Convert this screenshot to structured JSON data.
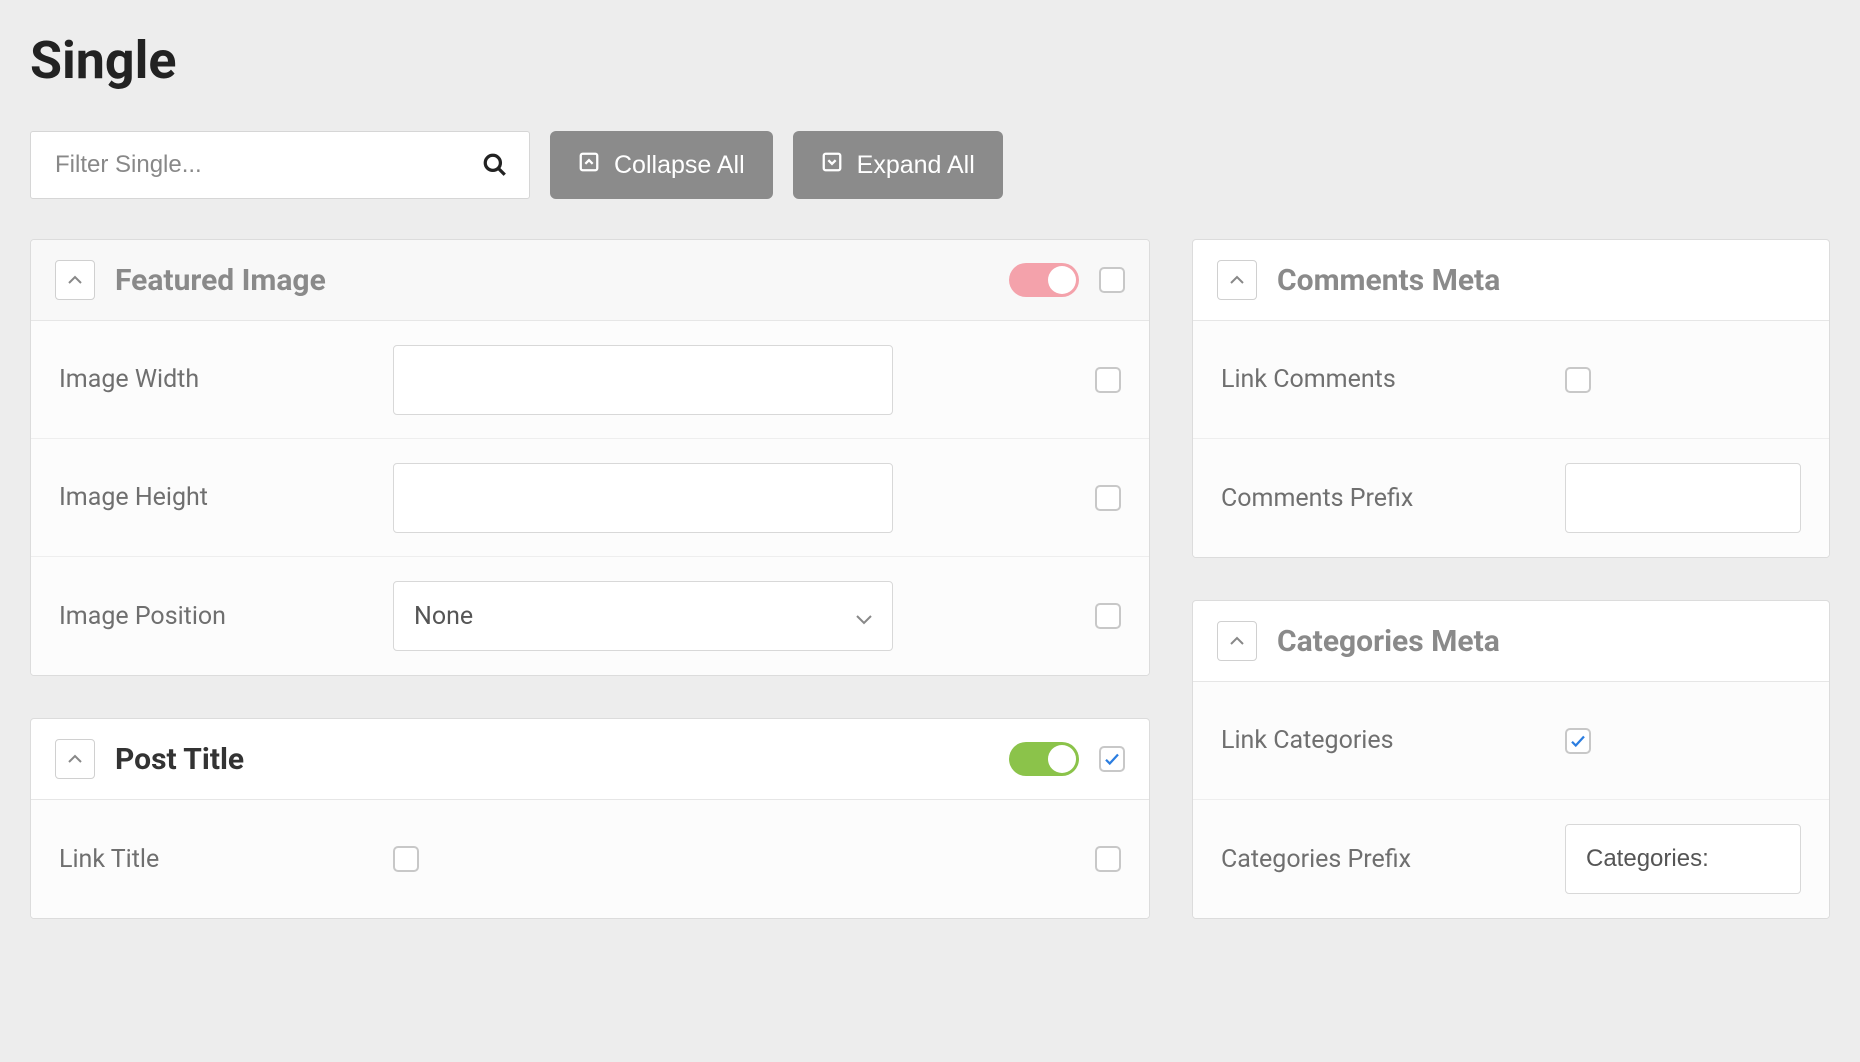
{
  "page": {
    "title": "Single"
  },
  "toolbar": {
    "filter_placeholder": "Filter Single...",
    "collapse_label": "Collapse All",
    "expand_label": "Expand All"
  },
  "panels": {
    "featured_image": {
      "title": "Featured Image",
      "enabled": false,
      "rows": {
        "image_width": {
          "label": "Image Width",
          "value": ""
        },
        "image_height": {
          "label": "Image Height",
          "value": ""
        },
        "image_position": {
          "label": "Image Position",
          "selected": "None"
        }
      }
    },
    "post_title": {
      "title": "Post Title",
      "enabled": true,
      "header_checkbox": true,
      "rows": {
        "link_title": {
          "label": "Link Title",
          "checked": false
        }
      }
    },
    "comments_meta": {
      "title": "Comments Meta",
      "rows": {
        "link_comments": {
          "label": "Link Comments",
          "checked": false
        },
        "comments_prefix": {
          "label": "Comments Prefix",
          "value": ""
        }
      }
    },
    "categories_meta": {
      "title": "Categories Meta",
      "rows": {
        "link_categories": {
          "label": "Link Categories",
          "checked": true
        },
        "categories_prefix": {
          "label": "Categories Prefix",
          "value": "Categories:"
        }
      }
    }
  }
}
